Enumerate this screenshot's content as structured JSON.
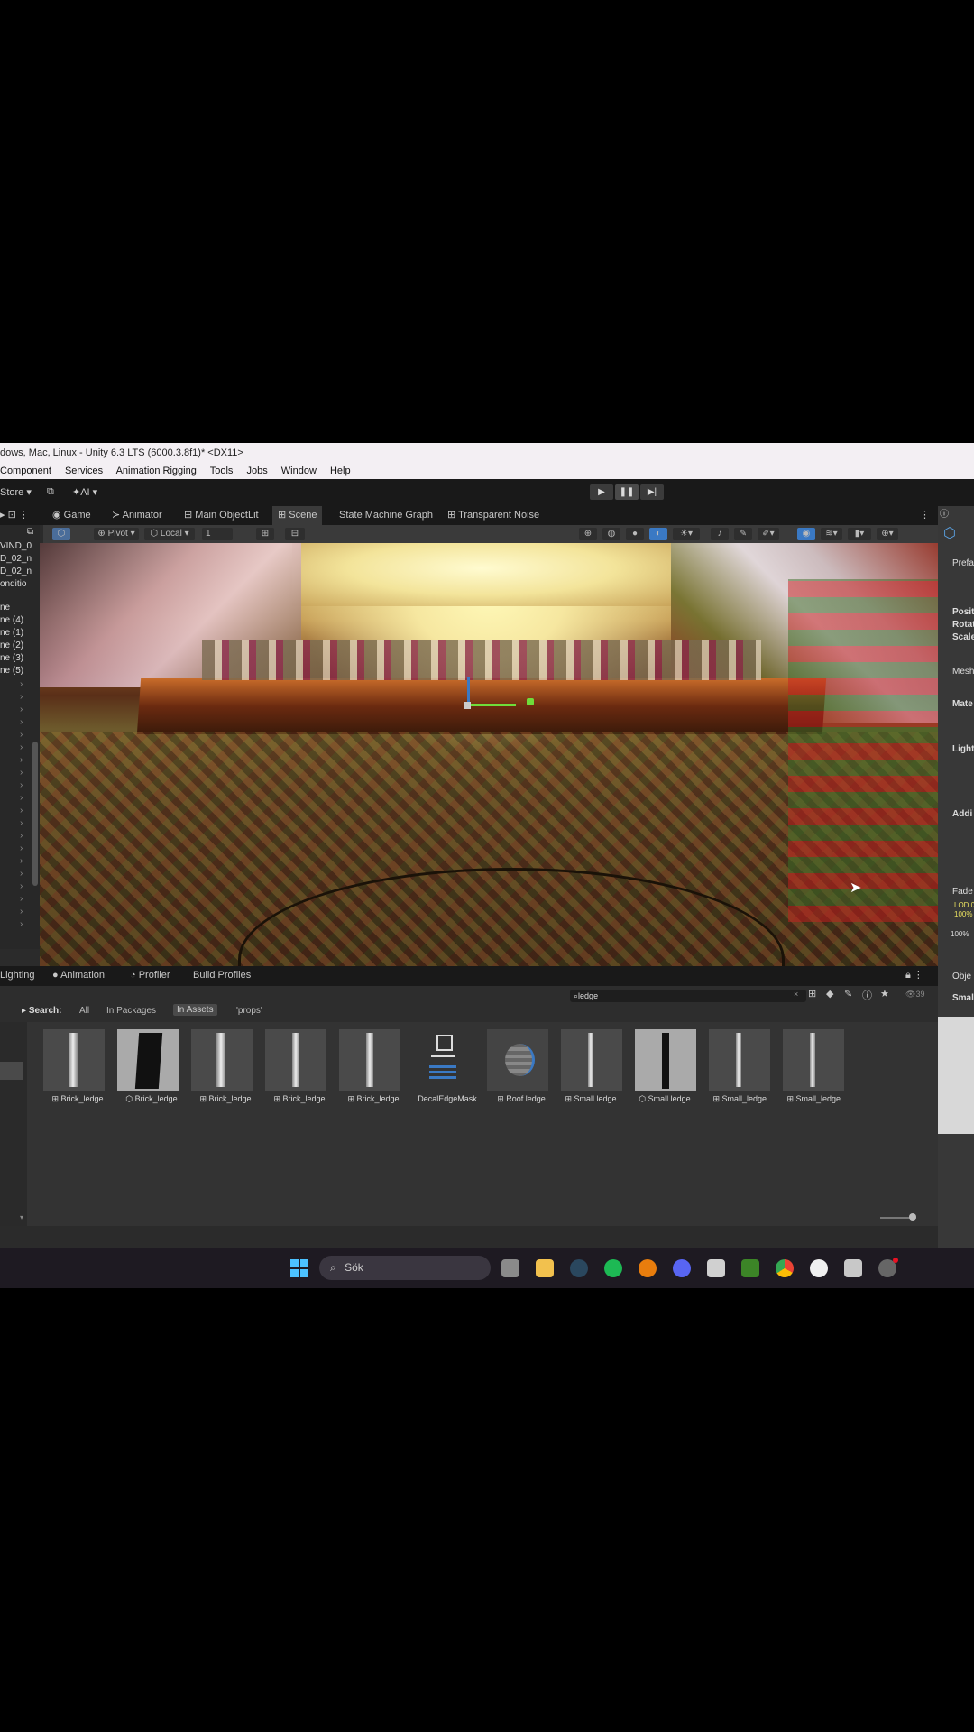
{
  "window": {
    "title": "dows, Mac, Linux - Unity 6.3 LTS (6000.3.8f1)* <DX11>"
  },
  "menu": [
    "Component",
    "Services",
    "Animation Rigging",
    "Tools",
    "Jobs",
    "Window",
    "Help"
  ],
  "toolbar": {
    "store_label": "Store",
    "ai_label": "AI",
    "play_icon": "▶",
    "pause_icon": "❚❚",
    "step_icon": "▶|"
  },
  "tabs": [
    "Game",
    "Animator",
    "Main ObjectLit",
    "Scene",
    "State Machine Graph",
    "Transparent Noise"
  ],
  "scene_toolbar": {
    "pivot_label": "Pivot",
    "local_label": "Local",
    "snap_value": "1"
  },
  "hierarchy": {
    "items": [
      "VIND_0",
      "D_02_n",
      "D_02_n",
      "onditio",
      "ne",
      "ne (4)",
      "ne (1)",
      "ne (2)",
      "ne (3)",
      "ne (5)"
    ]
  },
  "inspector": {
    "labels": [
      "Prefa",
      "Posit",
      "Rotat",
      "Scale",
      "Mesh",
      "Mate",
      "Light",
      "Addi",
      "Fade",
      "LOD 0",
      "100%",
      "100%",
      "Obje",
      "Small l"
    ]
  },
  "bottom_tabs": [
    "Lighting",
    "Animation",
    "Profiler",
    "Build Profiles"
  ],
  "search": {
    "label": "Search:",
    "scopes": [
      "All",
      "In Packages",
      "In Assets",
      "'props'"
    ],
    "query": "ledge",
    "result_count": "39"
  },
  "assets": [
    {
      "name": "Brick_ledge",
      "type": "mesh"
    },
    {
      "name": "Brick_ledge",
      "type": "prefab"
    },
    {
      "name": "Brick_ledge",
      "type": "mesh"
    },
    {
      "name": "Brick_ledge",
      "type": "mesh"
    },
    {
      "name": "Brick_ledge",
      "type": "mesh"
    },
    {
      "name": "DecalEdgeMask",
      "type": "shader-graph"
    },
    {
      "name": "Roof ledge",
      "type": "mesh"
    },
    {
      "name": "Small ledge ...",
      "type": "mesh"
    },
    {
      "name": "Small ledge ...",
      "type": "prefab"
    },
    {
      "name": "Small_ledge...",
      "type": "mesh"
    },
    {
      "name": "Small_ledge...",
      "type": "mesh"
    }
  ],
  "taskbar": {
    "search_placeholder": "Sök",
    "apps": [
      "windows-start-icon",
      "task-view-icon",
      "file-explorer-icon",
      "steam-icon",
      "spotify-icon",
      "blender-icon",
      "discord-icon",
      "unity-hub-icon",
      "minecraft-icon",
      "chrome-icon",
      "github-icon",
      "unity-editor-icon",
      "app-icon"
    ]
  },
  "colors": {
    "accent": "#3a79c4",
    "spotify": "#1db954",
    "discord": "#5865f2",
    "minecraft": "#3c8527"
  }
}
